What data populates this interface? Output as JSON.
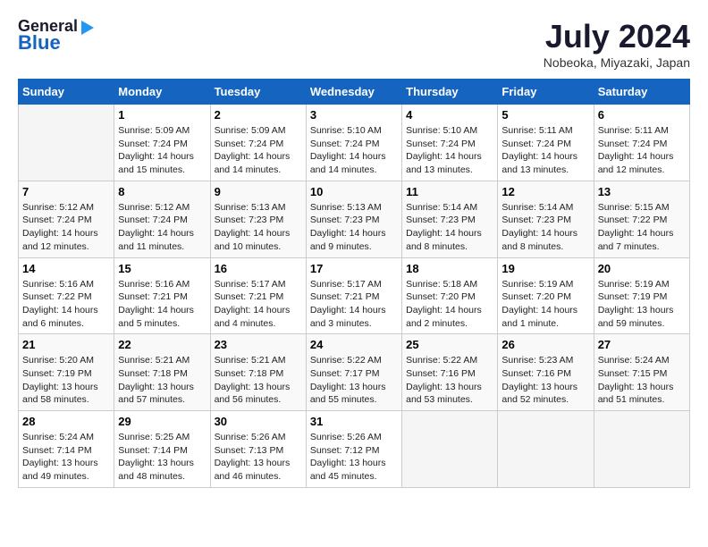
{
  "header": {
    "logo_line1": "General",
    "logo_line2": "Blue",
    "month": "July 2024",
    "location": "Nobeoka, Miyazaki, Japan"
  },
  "days_of_week": [
    "Sunday",
    "Monday",
    "Tuesday",
    "Wednesday",
    "Thursday",
    "Friday",
    "Saturday"
  ],
  "weeks": [
    [
      {
        "day": "",
        "empty": true
      },
      {
        "day": "1",
        "sunrise": "5:09 AM",
        "sunset": "7:24 PM",
        "daylight": "14 hours and 15 minutes."
      },
      {
        "day": "2",
        "sunrise": "5:09 AM",
        "sunset": "7:24 PM",
        "daylight": "14 hours and 14 minutes."
      },
      {
        "day": "3",
        "sunrise": "5:10 AM",
        "sunset": "7:24 PM",
        "daylight": "14 hours and 14 minutes."
      },
      {
        "day": "4",
        "sunrise": "5:10 AM",
        "sunset": "7:24 PM",
        "daylight": "14 hours and 13 minutes."
      },
      {
        "day": "5",
        "sunrise": "5:11 AM",
        "sunset": "7:24 PM",
        "daylight": "14 hours and 13 minutes."
      },
      {
        "day": "6",
        "sunrise": "5:11 AM",
        "sunset": "7:24 PM",
        "daylight": "14 hours and 12 minutes."
      }
    ],
    [
      {
        "day": "7",
        "sunrise": "5:12 AM",
        "sunset": "7:24 PM",
        "daylight": "14 hours and 12 minutes."
      },
      {
        "day": "8",
        "sunrise": "5:12 AM",
        "sunset": "7:24 PM",
        "daylight": "14 hours and 11 minutes."
      },
      {
        "day": "9",
        "sunrise": "5:13 AM",
        "sunset": "7:23 PM",
        "daylight": "14 hours and 10 minutes."
      },
      {
        "day": "10",
        "sunrise": "5:13 AM",
        "sunset": "7:23 PM",
        "daylight": "14 hours and 9 minutes."
      },
      {
        "day": "11",
        "sunrise": "5:14 AM",
        "sunset": "7:23 PM",
        "daylight": "14 hours and 8 minutes."
      },
      {
        "day": "12",
        "sunrise": "5:14 AM",
        "sunset": "7:23 PM",
        "daylight": "14 hours and 8 minutes."
      },
      {
        "day": "13",
        "sunrise": "5:15 AM",
        "sunset": "7:22 PM",
        "daylight": "14 hours and 7 minutes."
      }
    ],
    [
      {
        "day": "14",
        "sunrise": "5:16 AM",
        "sunset": "7:22 PM",
        "daylight": "14 hours and 6 minutes."
      },
      {
        "day": "15",
        "sunrise": "5:16 AM",
        "sunset": "7:21 PM",
        "daylight": "14 hours and 5 minutes."
      },
      {
        "day": "16",
        "sunrise": "5:17 AM",
        "sunset": "7:21 PM",
        "daylight": "14 hours and 4 minutes."
      },
      {
        "day": "17",
        "sunrise": "5:17 AM",
        "sunset": "7:21 PM",
        "daylight": "14 hours and 3 minutes."
      },
      {
        "day": "18",
        "sunrise": "5:18 AM",
        "sunset": "7:20 PM",
        "daylight": "14 hours and 2 minutes."
      },
      {
        "day": "19",
        "sunrise": "5:19 AM",
        "sunset": "7:20 PM",
        "daylight": "14 hours and 1 minute."
      },
      {
        "day": "20",
        "sunrise": "5:19 AM",
        "sunset": "7:19 PM",
        "daylight": "13 hours and 59 minutes."
      }
    ],
    [
      {
        "day": "21",
        "sunrise": "5:20 AM",
        "sunset": "7:19 PM",
        "daylight": "13 hours and 58 minutes."
      },
      {
        "day": "22",
        "sunrise": "5:21 AM",
        "sunset": "7:18 PM",
        "daylight": "13 hours and 57 minutes."
      },
      {
        "day": "23",
        "sunrise": "5:21 AM",
        "sunset": "7:18 PM",
        "daylight": "13 hours and 56 minutes."
      },
      {
        "day": "24",
        "sunrise": "5:22 AM",
        "sunset": "7:17 PM",
        "daylight": "13 hours and 55 minutes."
      },
      {
        "day": "25",
        "sunrise": "5:22 AM",
        "sunset": "7:16 PM",
        "daylight": "13 hours and 53 minutes."
      },
      {
        "day": "26",
        "sunrise": "5:23 AM",
        "sunset": "7:16 PM",
        "daylight": "13 hours and 52 minutes."
      },
      {
        "day": "27",
        "sunrise": "5:24 AM",
        "sunset": "7:15 PM",
        "daylight": "13 hours and 51 minutes."
      }
    ],
    [
      {
        "day": "28",
        "sunrise": "5:24 AM",
        "sunset": "7:14 PM",
        "daylight": "13 hours and 49 minutes."
      },
      {
        "day": "29",
        "sunrise": "5:25 AM",
        "sunset": "7:14 PM",
        "daylight": "13 hours and 48 minutes."
      },
      {
        "day": "30",
        "sunrise": "5:26 AM",
        "sunset": "7:13 PM",
        "daylight": "13 hours and 46 minutes."
      },
      {
        "day": "31",
        "sunrise": "5:26 AM",
        "sunset": "7:12 PM",
        "daylight": "13 hours and 45 minutes."
      },
      {
        "day": "",
        "empty": true
      },
      {
        "day": "",
        "empty": true
      },
      {
        "day": "",
        "empty": true
      }
    ]
  ],
  "labels": {
    "sunrise": "Sunrise:",
    "sunset": "Sunset:",
    "daylight": "Daylight:"
  }
}
